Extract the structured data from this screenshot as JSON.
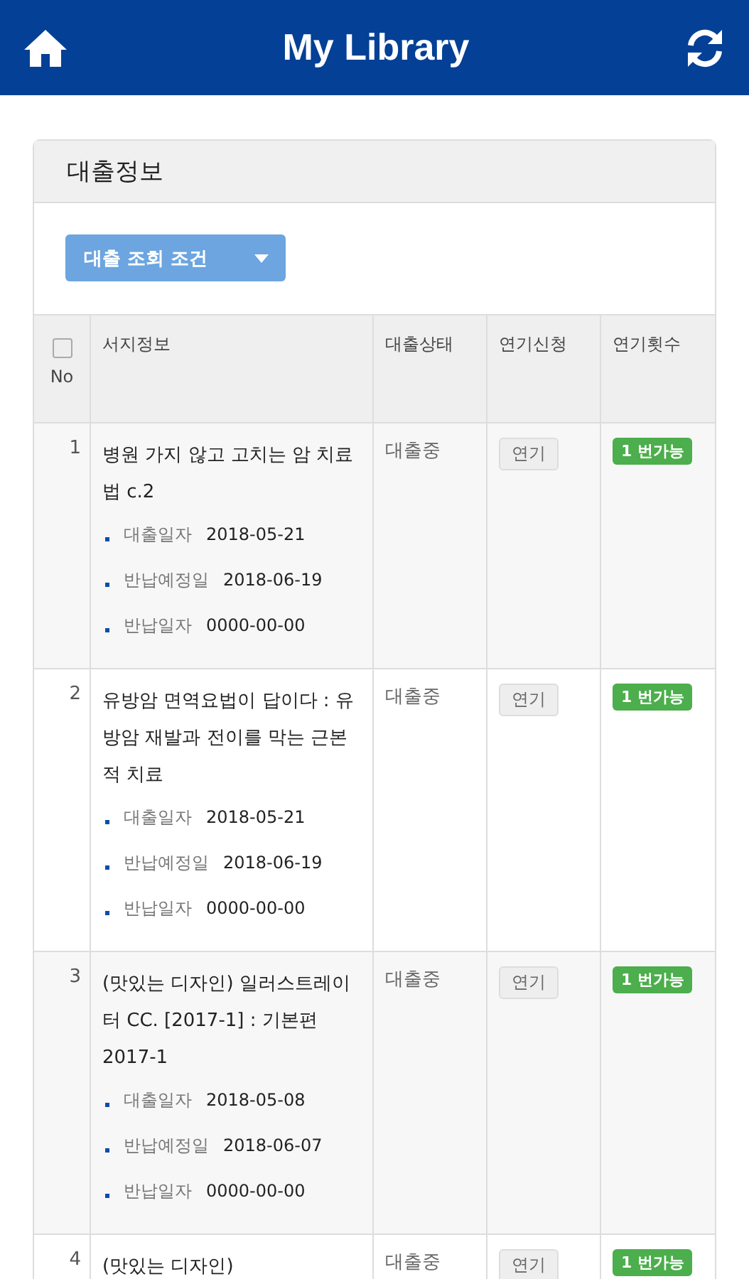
{
  "app_bar": {
    "title": "My Library"
  },
  "panel": {
    "title": "대출정보",
    "filter_button": "대출 조회 조건"
  },
  "table": {
    "select_all": {
      "checked": false
    },
    "columns": [
      {
        "label": "No"
      },
      {
        "label": "서지정보"
      },
      {
        "label": "대출상태"
      },
      {
        "label": "연기신청"
      },
      {
        "label": "연기횟수"
      }
    ],
    "rows": [
      {
        "no": "1",
        "title": "병원 가지 않고 고치는 암 치료법 c.2",
        "dates": [
          {
            "label": "대출일자",
            "value": "2018-05-21"
          },
          {
            "label": "반납예정일",
            "value": "2018-06-19"
          },
          {
            "label": "반납일자",
            "value": "0000-00-00"
          }
        ],
        "status": "대출중",
        "extend_button": "연기",
        "count_badge": "1 번가능"
      },
      {
        "no": "2",
        "title": "유방암 면역요법이 답이다 : 유방암 재발과 전이를 막는 근본적 치료",
        "dates": [
          {
            "label": "대출일자",
            "value": "2018-05-21"
          },
          {
            "label": "반납예정일",
            "value": "2018-06-19"
          },
          {
            "label": "반납일자",
            "value": "0000-00-00"
          }
        ],
        "status": "대출중",
        "extend_button": "연기",
        "count_badge": "1 번가능"
      },
      {
        "no": "3",
        "title": "(맛있는 디자인) 일러스트레이터 CC. [2017-1] : 기본편 2017-1",
        "dates": [
          {
            "label": "대출일자",
            "value": "2018-05-08"
          },
          {
            "label": "반납예정일",
            "value": "2018-06-07"
          },
          {
            "label": "반납일자",
            "value": "0000-00-00"
          }
        ],
        "status": "대출중",
        "extend_button": "연기",
        "count_badge": "1 번가능"
      },
      {
        "no": "4",
        "title": "(맛있는 디자인)",
        "status": "대출중",
        "extend_button": "연기",
        "count_badge": "1 번가능"
      }
    ]
  }
}
